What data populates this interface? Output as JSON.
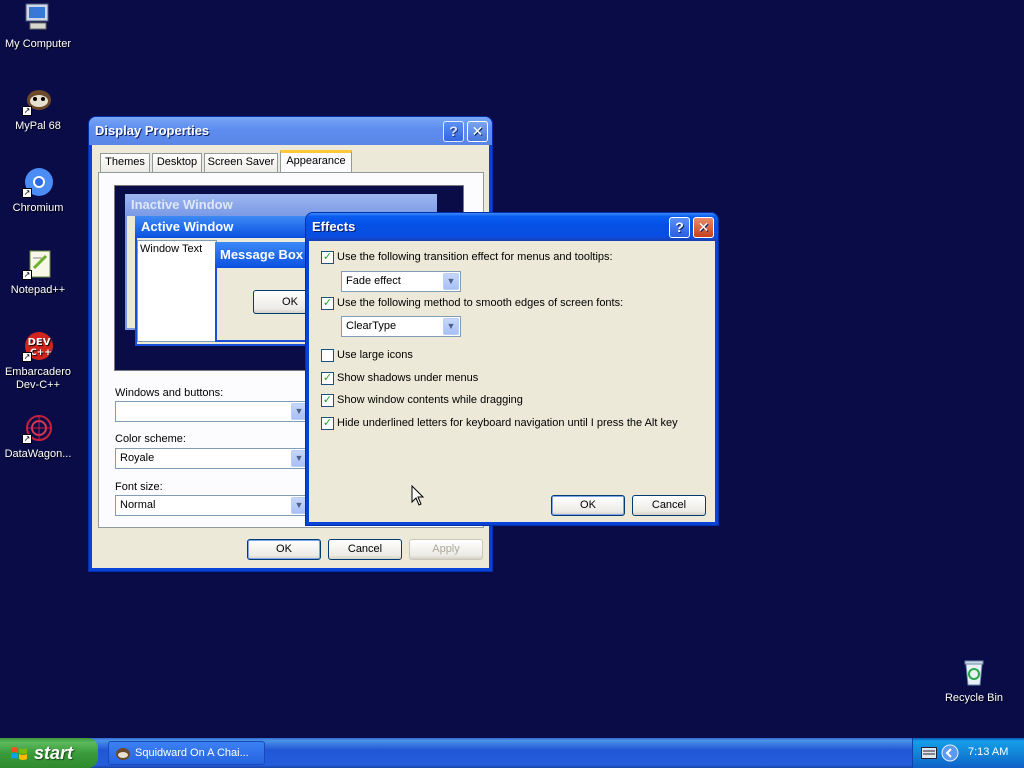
{
  "desktop": {
    "icons": [
      {
        "label": "My Computer",
        "icon": "my-computer-icon"
      },
      {
        "label": "MyPal 68",
        "icon": "mypal-icon"
      },
      {
        "label": "Chromium",
        "icon": "chromium-icon"
      },
      {
        "label": "Notepad++",
        "icon": "notepadpp-icon"
      },
      {
        "label": "Embarcadero Dev-C++",
        "icon": "devcpp-icon"
      },
      {
        "label": "DataWagon...",
        "icon": "datawagon-icon"
      },
      {
        "label": "Recycle Bin",
        "icon": "recycle-bin-icon"
      }
    ],
    "background_color": "#0a0c48"
  },
  "display_properties": {
    "title": "Display Properties",
    "help_symbol": "?",
    "close_symbol": "✕",
    "tabs": [
      "Themes",
      "Desktop",
      "Screen Saver",
      "Appearance"
    ],
    "active_tab": "Appearance",
    "preview": {
      "inactive_title": "Inactive Window",
      "active_title": "Active Window",
      "window_text": "Window Text",
      "message_box_title": "Message Box",
      "ok_label": "OK"
    },
    "windows_and_buttons_label": "Windows and buttons:",
    "windows_and_buttons_value": "",
    "color_scheme_label": "Color scheme:",
    "color_scheme_value": "Royale",
    "font_size_label": "Font size:",
    "font_size_value": "Normal",
    "ok_label": "OK",
    "cancel_label": "Cancel",
    "apply_label": "Apply"
  },
  "effects": {
    "title": "Effects",
    "help_symbol": "?",
    "close_symbol": "✕",
    "options": [
      {
        "label": "Use the following transition effect for menus and tooltips:",
        "checked": true
      },
      {
        "label": "Use the following method to smooth edges of screen fonts:",
        "checked": true
      },
      {
        "label": "Use large icons",
        "checked": false
      },
      {
        "label": "Show shadows under menus",
        "checked": true
      },
      {
        "label": "Show window contents while dragging",
        "checked": true
      },
      {
        "label": "Hide underlined letters for keyboard navigation until I press the Alt key",
        "checked": true
      }
    ],
    "transition_value": "Fade effect",
    "smoothing_value": "ClearType",
    "check_symbol": "✓",
    "ok_label": "OK",
    "cancel_label": "Cancel"
  },
  "taskbar": {
    "start_label": "start",
    "task_label": "Squidward On A Chai...",
    "clock": "7:13 AM"
  }
}
